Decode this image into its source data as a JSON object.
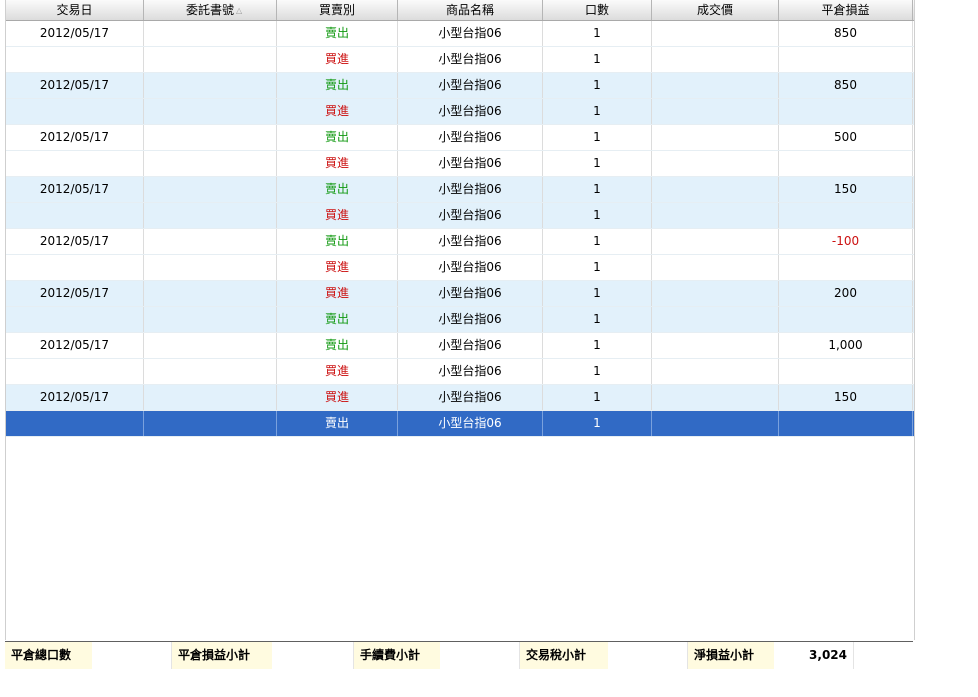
{
  "columns": [
    "交易日",
    "委託書號",
    "買賣別",
    "商品名稱",
    "口數",
    "成交價",
    "平倉損益"
  ],
  "sort_indicator": "△",
  "rows": [
    {
      "date": "2012/05/17",
      "order": "",
      "side": "賣出",
      "side_type": "sell",
      "product": "小型台指06",
      "qty": "1",
      "price": "",
      "pnl": "850",
      "pnl_type": "pos"
    },
    {
      "date": "",
      "order": "",
      "side": "買進",
      "side_type": "buy",
      "product": "小型台指06",
      "qty": "1",
      "price": "",
      "pnl": "",
      "pnl_type": "pos"
    },
    {
      "date": "2012/05/17",
      "order": "",
      "side": "賣出",
      "side_type": "sell",
      "product": "小型台指06",
      "qty": "1",
      "price": "",
      "pnl": "850",
      "pnl_type": "pos"
    },
    {
      "date": "",
      "order": "",
      "side": "買進",
      "side_type": "buy",
      "product": "小型台指06",
      "qty": "1",
      "price": "",
      "pnl": "",
      "pnl_type": "pos"
    },
    {
      "date": "2012/05/17",
      "order": "",
      "side": "賣出",
      "side_type": "sell",
      "product": "小型台指06",
      "qty": "1",
      "price": "",
      "pnl": "500",
      "pnl_type": "pos"
    },
    {
      "date": "",
      "order": "",
      "side": "買進",
      "side_type": "buy",
      "product": "小型台指06",
      "qty": "1",
      "price": "",
      "pnl": "",
      "pnl_type": "pos"
    },
    {
      "date": "2012/05/17",
      "order": "",
      "side": "賣出",
      "side_type": "sell",
      "product": "小型台指06",
      "qty": "1",
      "price": "",
      "pnl": "150",
      "pnl_type": "pos"
    },
    {
      "date": "",
      "order": "",
      "side": "買進",
      "side_type": "buy",
      "product": "小型台指06",
      "qty": "1",
      "price": "",
      "pnl": "",
      "pnl_type": "pos"
    },
    {
      "date": "2012/05/17",
      "order": "",
      "side": "賣出",
      "side_type": "sell",
      "product": "小型台指06",
      "qty": "1",
      "price": "",
      "pnl": "-100",
      "pnl_type": "neg"
    },
    {
      "date": "",
      "order": "",
      "side": "買進",
      "side_type": "buy",
      "product": "小型台指06",
      "qty": "1",
      "price": "",
      "pnl": "",
      "pnl_type": "pos"
    },
    {
      "date": "2012/05/17",
      "order": "",
      "side": "買進",
      "side_type": "buy",
      "product": "小型台指06",
      "qty": "1",
      "price": "",
      "pnl": "200",
      "pnl_type": "pos"
    },
    {
      "date": "",
      "order": "",
      "side": "賣出",
      "side_type": "sell",
      "product": "小型台指06",
      "qty": "1",
      "price": "",
      "pnl": "",
      "pnl_type": "pos"
    },
    {
      "date": "2012/05/17",
      "order": "",
      "side": "賣出",
      "side_type": "sell",
      "product": "小型台指06",
      "qty": "1",
      "price": "",
      "pnl": "1,000",
      "pnl_type": "pos"
    },
    {
      "date": "",
      "order": "",
      "side": "買進",
      "side_type": "buy",
      "product": "小型台指06",
      "qty": "1",
      "price": "",
      "pnl": "",
      "pnl_type": "pos"
    },
    {
      "date": "2012/05/17",
      "order": "",
      "side": "買進",
      "side_type": "buy",
      "product": "小型台指06",
      "qty": "1",
      "price": "",
      "pnl": "150",
      "pnl_type": "pos"
    },
    {
      "date": "",
      "order": "",
      "side": "賣出",
      "side_type": "sell",
      "product": "小型台指06",
      "qty": "1",
      "price": "",
      "pnl": "",
      "pnl_type": "pos",
      "selected": true
    }
  ],
  "footer": {
    "total_qty_label": "平倉總口數",
    "total_qty_value": "",
    "pnl_subtotal_label": "平倉損益小計",
    "pnl_subtotal_value": "",
    "fee_subtotal_label": "手續費小計",
    "fee_subtotal_value": "",
    "tax_subtotal_label": "交易稅小計",
    "tax_subtotal_value": "",
    "net_pnl_label": "淨損益小計",
    "net_pnl_value": "3,024"
  },
  "colors": {
    "sell": "#119911",
    "buy": "#cc1111",
    "row_alt": "#e2f1fb",
    "selected": "#316ac5"
  }
}
